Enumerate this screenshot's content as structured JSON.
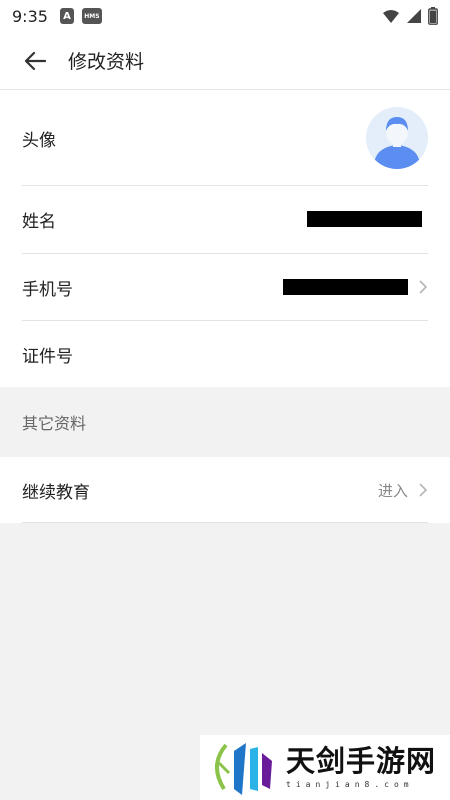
{
  "status_bar": {
    "time": "9:35",
    "badges": [
      "A",
      "HMS"
    ],
    "icons": [
      "wifi-icon",
      "signal-icon",
      "battery-icon"
    ]
  },
  "header": {
    "back_icon": "arrow-left-icon",
    "title": "修改资料"
  },
  "profile": {
    "avatar_label": "头像",
    "name_label": "姓名",
    "phone_label": "手机号",
    "id_label": "证件号"
  },
  "other_section": {
    "title": "其它资料",
    "continuing_education_label": "继续教育",
    "enter_label": "进入"
  },
  "watermark": {
    "text": "天剑手游网",
    "subtext": "tianjian8.com"
  },
  "colors": {
    "background": "#f2f2f2",
    "surface": "#ffffff",
    "divider": "#e3e3e3",
    "avatar": "#5b8ef0",
    "redaction": "#000000"
  }
}
